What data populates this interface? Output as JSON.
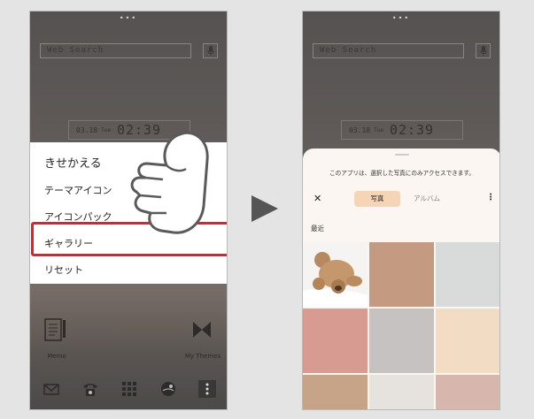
{
  "left_phone": {
    "search_text": "Web Search",
    "clock": {
      "date": "03.18",
      "weekday": "Tue",
      "time": "02:39"
    },
    "menu": {
      "title": "きせかえる",
      "items": [
        "テーマアイコン",
        "アイコンパック",
        "ギャラリー",
        "リセット"
      ],
      "highlighted_item": "ギャラリー"
    },
    "apps": {
      "memo_label": "Memo",
      "themes_label": "My Themes"
    },
    "dock_icons": [
      "mail-icon",
      "phone-icon",
      "apps-grid-icon",
      "browser-icon",
      "more-icon"
    ]
  },
  "right_phone": {
    "search_text": "Web Search",
    "clock": {
      "date": "03.18",
      "weekday": "Tue",
      "time": "02:39"
    },
    "picker": {
      "notice": "このアプリは、選択した写真にのみアクセスできます。",
      "tabs": [
        "写真",
        "アルバム"
      ],
      "selected_tab": "写真",
      "section_label": "最近",
      "thumbnails": [
        "#ffffff",
        "#c49a81",
        "#d9dbdb",
        "#d79b92",
        "#c5c2c1",
        "#f3dcc4",
        "#c7a388",
        "#e6e2dd",
        "#d7b6ad"
      ]
    }
  },
  "colors": {
    "highlight": "#e51e2b",
    "selected_tab_bg": "#f6d5b7"
  }
}
